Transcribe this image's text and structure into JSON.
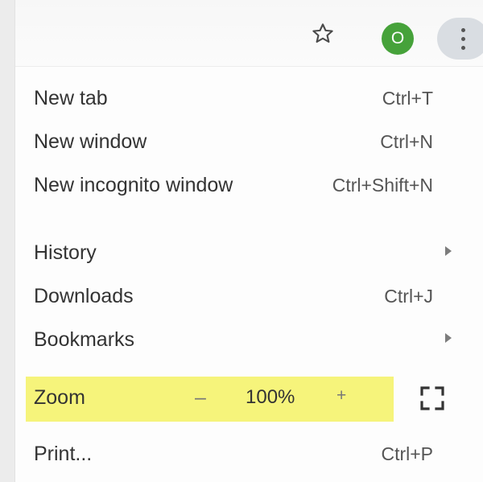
{
  "toolbar": {
    "profile_initial": "O",
    "bookmark_icon": "star-outline-icon",
    "menu_icon": "vertical-dots-icon",
    "avatar_color": "#46a23a"
  },
  "menu": {
    "new_tab": {
      "label": "New tab",
      "shortcut": "Ctrl+T"
    },
    "new_window": {
      "label": "New window",
      "shortcut": "Ctrl+N"
    },
    "new_incognito": {
      "label": "New incognito window",
      "shortcut": "Ctrl+Shift+N"
    },
    "history": {
      "label": "History"
    },
    "downloads": {
      "label": "Downloads",
      "shortcut": "Ctrl+J"
    },
    "bookmarks": {
      "label": "Bookmarks"
    },
    "zoom": {
      "label": "Zoom",
      "minus": "–",
      "value": "100%",
      "plus": "+",
      "highlight_color": "#f6f47b"
    },
    "print": {
      "label": "Print...",
      "shortcut": "Ctrl+P"
    }
  }
}
